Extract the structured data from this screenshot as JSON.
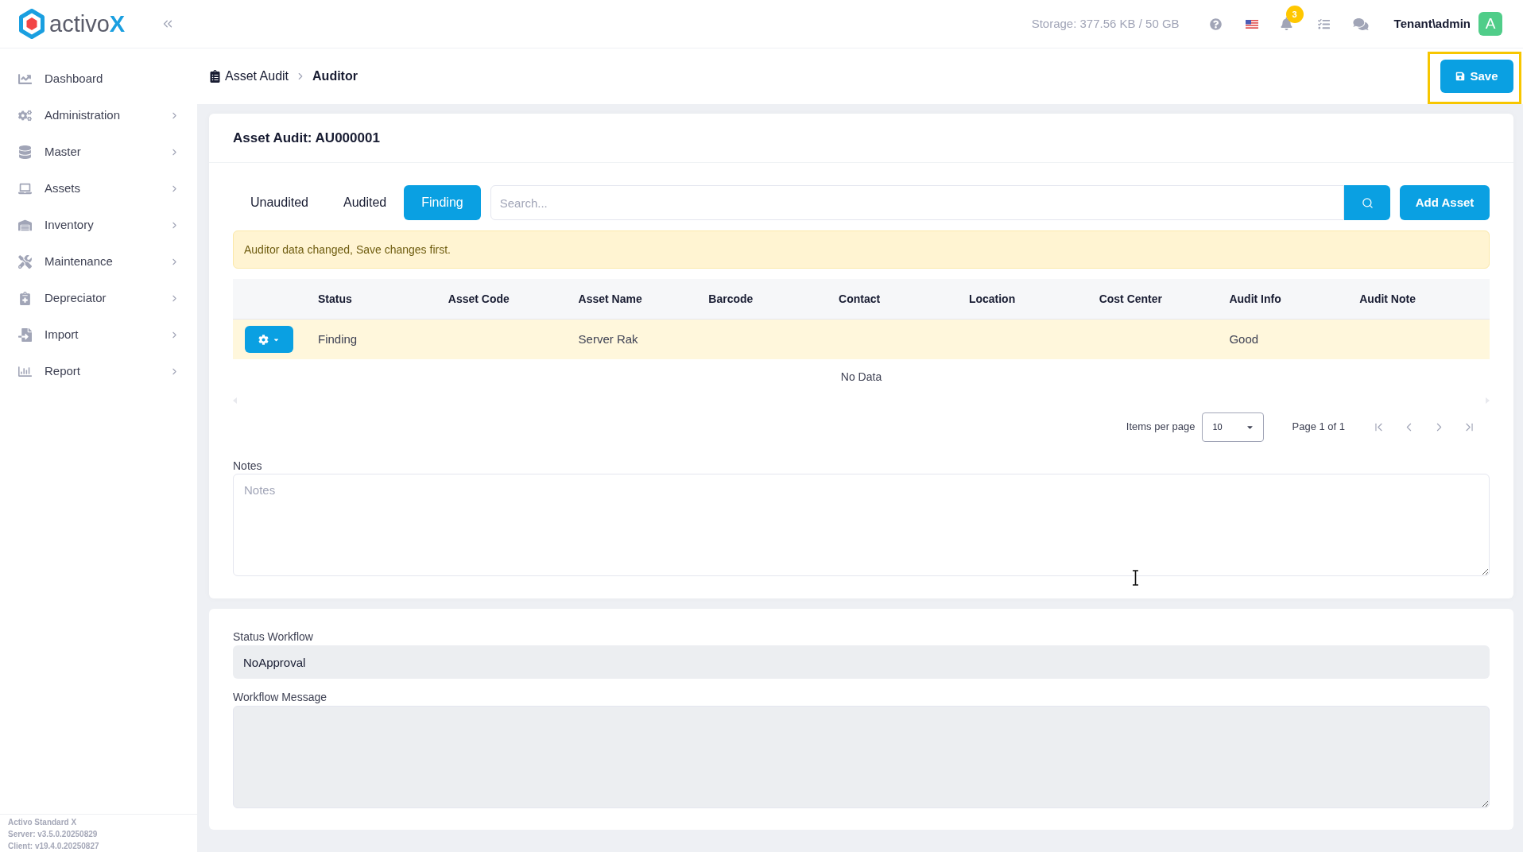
{
  "sidebar": {
    "logo": {
      "text": "activo",
      "accent": "X"
    },
    "items": [
      {
        "label": "Dashboard",
        "expandable": false
      },
      {
        "label": "Administration",
        "expandable": true
      },
      {
        "label": "Master",
        "expandable": true
      },
      {
        "label": "Assets",
        "expandable": true
      },
      {
        "label": "Inventory",
        "expandable": true
      },
      {
        "label": "Maintenance",
        "expandable": true
      },
      {
        "label": "Depreciator",
        "expandable": true
      },
      {
        "label": "Import",
        "expandable": true
      },
      {
        "label": "Report",
        "expandable": true
      }
    ],
    "footer": [
      "Activo Standard X",
      "Server: v3.5.0.20250829",
      "Client: v19.4.0.20250827"
    ]
  },
  "topbar": {
    "storage": "Storage: 377.56 KB / 50 GB",
    "notification_count": "3",
    "user": "Tenant\\admin",
    "avatar": "A"
  },
  "breadcrumb": [
    {
      "label": "Asset Audit",
      "current": false
    },
    {
      "label": "Auditor",
      "current": true
    }
  ],
  "save_button": {
    "label": "Save",
    "highlighted": true
  },
  "audit": {
    "title": "Asset Audit: AU000001",
    "tabs": [
      {
        "label": "Unaudited",
        "selected": false
      },
      {
        "label": "Audited",
        "selected": false
      },
      {
        "label": "Finding",
        "selected": true
      }
    ],
    "search": {
      "placeholder": "Search..."
    },
    "add_button": "Add Asset",
    "alert": "Auditor data changed, Save changes first.",
    "table": {
      "columns": [
        "Status",
        "Asset Code",
        "Asset Name",
        "Barcode",
        "Contact",
        "Location",
        "Cost Center",
        "Audit Info",
        "Audit Note"
      ],
      "rows": [
        {
          "highlighted": true,
          "cells": [
            "Finding",
            null,
            "Server Rak",
            null,
            null,
            null,
            null,
            "Good",
            null
          ]
        }
      ],
      "empty_message": "No Data"
    },
    "pagination": {
      "items_per_page_label": "Items per page",
      "page_size": "10",
      "page_info": "Page 1 of 1"
    },
    "notes": {
      "label": "Notes",
      "placeholder": "Notes"
    }
  },
  "workflow": {
    "status": {
      "label": "Status Workflow",
      "value": "NoApproval",
      "disabled": true
    },
    "message": {
      "label": "Workflow Message",
      "disabled": true
    }
  }
}
